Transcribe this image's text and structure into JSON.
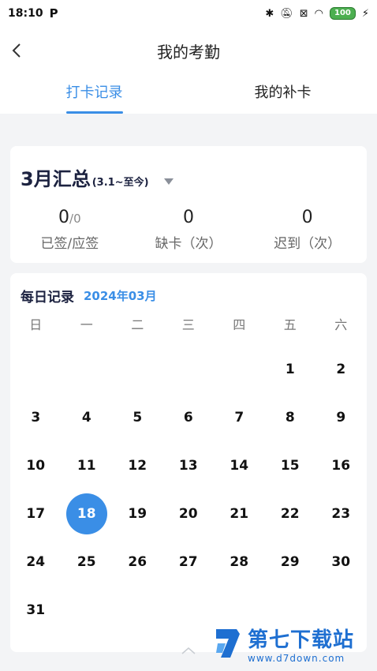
{
  "status_bar": {
    "time": "18:10",
    "app_badge": "P",
    "battery": "100",
    "icons": [
      "bluetooth-icon",
      "mute-icon",
      "sim-icon",
      "wifi-icon",
      "battery-icon",
      "charging-icon"
    ]
  },
  "header": {
    "title": "我的考勤",
    "back_icon": "back-arrow-icon"
  },
  "tabs": [
    {
      "label": "打卡记录",
      "active": true
    },
    {
      "label": "我的补卡",
      "active": false
    }
  ],
  "summary": {
    "title": "3月汇总",
    "range": "(3.1~至今)",
    "stats": [
      {
        "value": "0",
        "sub": "/0",
        "label": "已签/应签"
      },
      {
        "value": "0",
        "sub": "",
        "label": "缺卡（次）"
      },
      {
        "value": "0",
        "sub": "",
        "label": "迟到（次）"
      }
    ]
  },
  "calendar": {
    "title": "每日记录",
    "month": "2024年03月",
    "weekdays": [
      "日",
      "一",
      "二",
      "三",
      "四",
      "五",
      "六"
    ],
    "weeks": [
      [
        "",
        "",
        "",
        "",
        "",
        "1",
        "2"
      ],
      [
        "3",
        "4",
        "5",
        "6",
        "7",
        "8",
        "9"
      ],
      [
        "10",
        "11",
        "12",
        "13",
        "14",
        "15",
        "16"
      ],
      [
        "17",
        "18",
        "19",
        "20",
        "21",
        "22",
        "23"
      ],
      [
        "24",
        "25",
        "26",
        "27",
        "28",
        "29",
        "30"
      ],
      [
        "31",
        "",
        "",
        "",
        "",
        "",
        ""
      ]
    ],
    "selected": "18"
  },
  "watermark": {
    "title": "第七下载站",
    "url": "www.d7down.com"
  },
  "colors": {
    "accent": "#3a8ee6",
    "brand_watermark": "#1e6fd1"
  }
}
